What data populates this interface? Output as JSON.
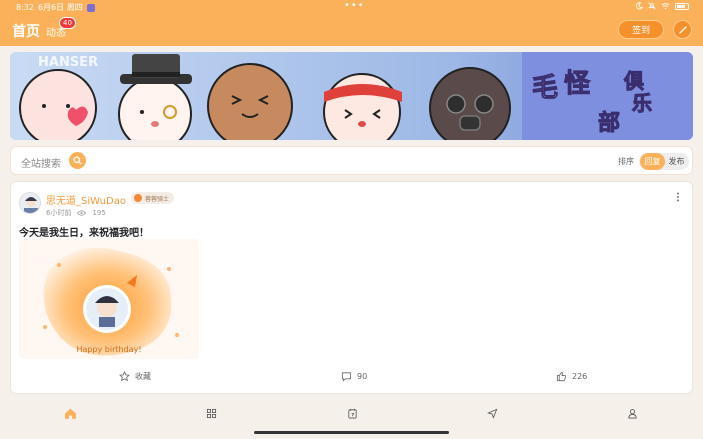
{
  "status_bar": {
    "time": "8:32",
    "date": "6月6日 周四",
    "dots": "•••",
    "icons": [
      "moon-icon",
      "bell-off-icon",
      "wifi-icon",
      "battery-icon"
    ]
  },
  "header": {
    "title": "首页",
    "dynamic_label": "动态",
    "dynamic_badge": "40",
    "signin_label": "签到",
    "pen_icon": "pen-icon",
    "background_color": "#fbb15a"
  },
  "banner": {
    "brand_text": "HANSER",
    "title_chars": [
      "毛",
      "怪",
      "俱",
      "乐",
      "部"
    ]
  },
  "search": {
    "placeholder": "全站搜索",
    "sort_label": "排序",
    "sort_options": [
      "回复",
      "发布"
    ],
    "sort_selected": "回复"
  },
  "post": {
    "author": "思无道_SiWuDao",
    "level_badge": "蓉蓉骑士",
    "time_ago": "6小时前",
    "views": "195",
    "text": "今天是我生日，来祝福我吧！",
    "image_caption": "Happy birthday!",
    "actions": {
      "favorite_label": "收藏",
      "comments": "90",
      "likes": "226"
    }
  },
  "bottom_nav": {
    "items": [
      "home-icon",
      "grid-icon",
      "calendar-icon",
      "send-icon",
      "profile-icon"
    ],
    "active": "home-icon"
  },
  "colors": {
    "accent": "#fbb15a",
    "accent_dark": "#f5912c",
    "author": "#f59a3a",
    "badge_red": "#f03a3a"
  }
}
